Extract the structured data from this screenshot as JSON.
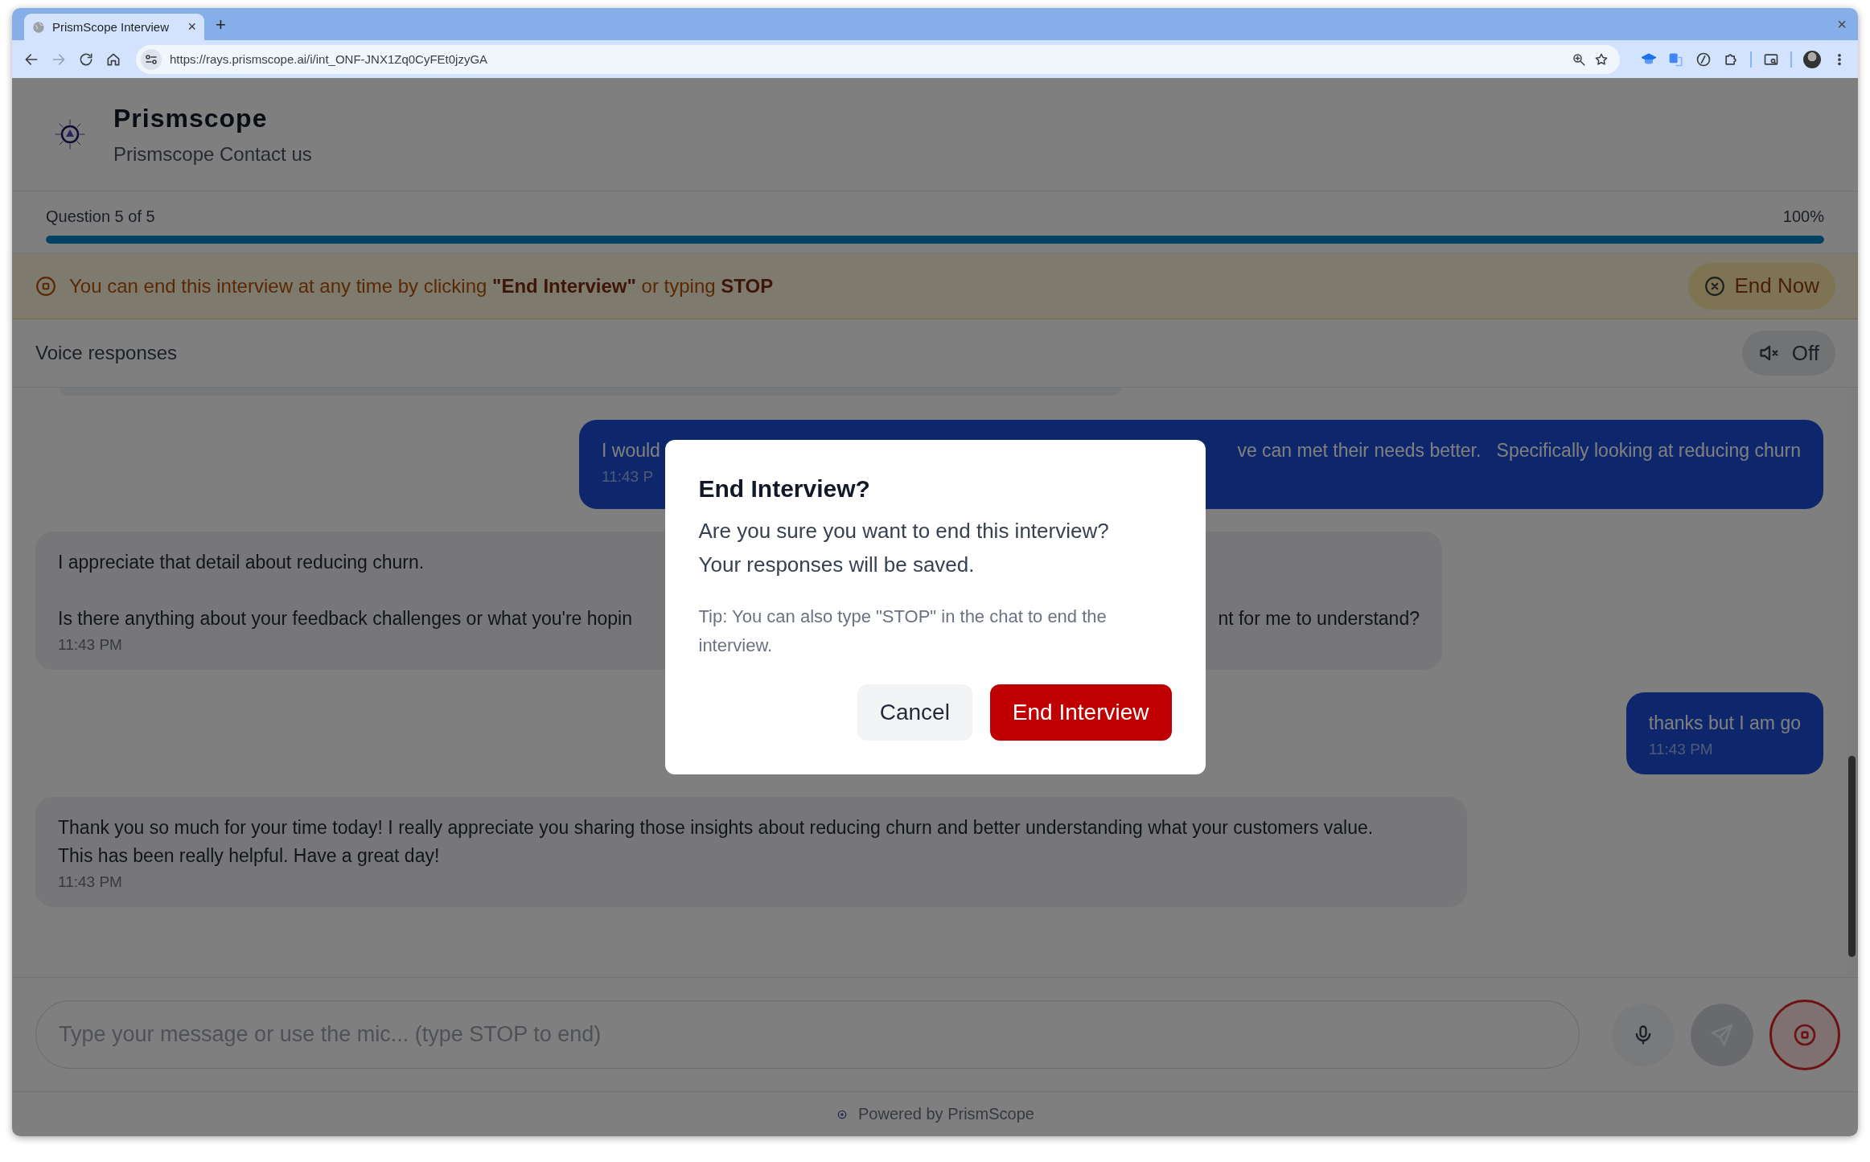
{
  "browser": {
    "tab": {
      "title": "PrismScope Interview",
      "close": "×"
    },
    "new_tab": "+",
    "window_close": "×",
    "forward_disabled": true,
    "url": "https://rays.prismscope.ai/i/int_ONF-JNX1Zq0CyFEt0jzyGA"
  },
  "header": {
    "title": "Prismscope",
    "subtitle": "Prismscope Contact us"
  },
  "progress": {
    "label": "Question 5 of 5",
    "percent": "100%",
    "level": 1
  },
  "banner": {
    "text": "You can end this interview at any time by clicking **\"End Interview\"** or typing **STOP**",
    "button": "End Now"
  },
  "voice": {
    "label": "Voice responses",
    "on": false,
    "button": "Off"
  },
  "messages": [
    {
      "kind": "user",
      "lines": [
        [
          "I would",
          "ve can met their needs better.   Specifically looking at reducing churn"
        ]
      ],
      "time": "11:43 P"
    },
    {
      "kind": "assistant",
      "lines": [
        [
          "I appreciate that detail about reducing churn."
        ],
        [
          "Is there anything about your feedback challenges or what you're hopin",
          "nt for me to understand?"
        ]
      ],
      "time": "11:43 PM"
    },
    {
      "kind": "user",
      "lines": [
        [
          "thanks but I am go"
        ]
      ],
      "time": "11:43 PM"
    },
    {
      "kind": "assistant",
      "lines": [
        [
          "Thank you so much for your time today! I really appreciate you sharing those insights about reducing churn and better understanding what your customers value. This has been really helpful. Have a great day!"
        ]
      ],
      "time": "11:43 PM"
    }
  ],
  "composer": {
    "placeholder": "Type your message or use the mic... (type STOP to end)"
  },
  "footer": {
    "text": "Powered by PrismScope"
  },
  "dialog": {
    "title": "End Interview?",
    "message": "Are you sure you want to end this interview? Your responses will be saved.",
    "tip": "Tip: You can also type \"STOP\" in the chat to end the interview.",
    "buttons": [
      {
        "label": "Cancel",
        "kind": "secondary"
      },
      {
        "label": "End Interview",
        "kind": "danger"
      }
    ]
  }
}
